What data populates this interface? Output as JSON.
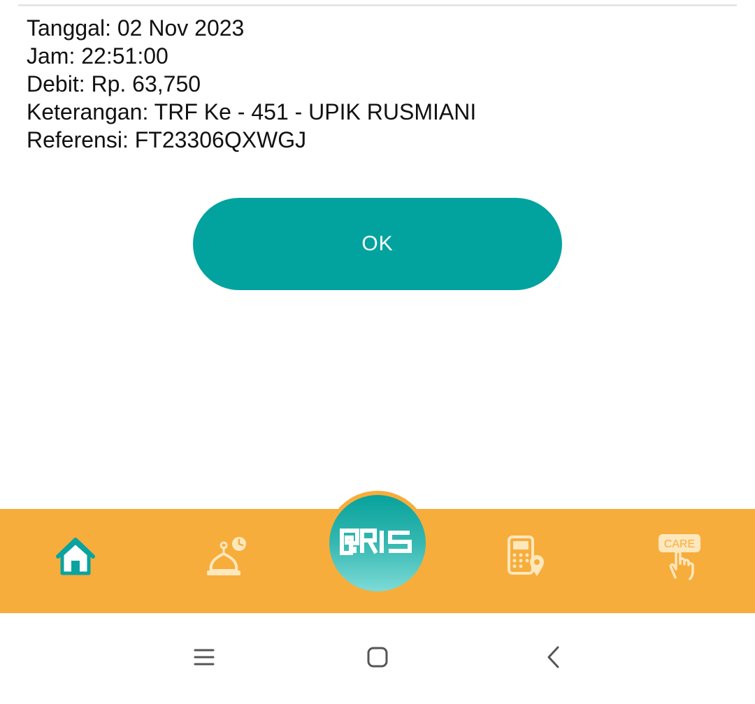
{
  "transaction": {
    "date_line": "Tanggal: 02 Nov 2023",
    "time_line": "Jam: 22:51:00",
    "debit_line": "Debit: Rp. 63,750",
    "description_line": "Keterangan: TRF Ke - 451 - UPIK RUSMIANI",
    "reference_line": "Referensi: FT23306QXWGJ"
  },
  "actions": {
    "ok_label": "OK"
  },
  "bottom_nav": {
    "items": [
      {
        "icon": "home-icon"
      },
      {
        "icon": "mosque-clock-icon"
      },
      {
        "icon": "qris-icon",
        "label": "QRIS"
      },
      {
        "icon": "atm-location-icon"
      },
      {
        "icon": "care-icon",
        "label": "CARE"
      }
    ]
  },
  "system_nav": {
    "items": [
      "menu-icon",
      "home-square-icon",
      "back-icon"
    ]
  },
  "colors": {
    "primary": "#02a39f",
    "nav_background": "#f7ad3b",
    "nav_icon": "#fde7bd",
    "text": "#111111"
  }
}
